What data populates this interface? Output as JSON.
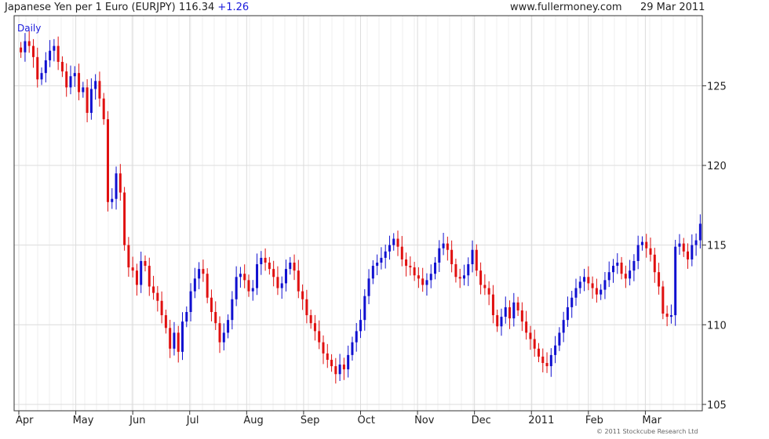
{
  "header": {
    "title": "Japanese Yen per 1 Euro (EURJPY) 116.34",
    "change": "+1.26",
    "site": "www.fullermoney.com",
    "date": "29 Mar 2011"
  },
  "copyright": "© 2011 Stockcube Research Ltd",
  "colors": {
    "up": "#1010d0",
    "down": "#e01010",
    "grid": "#dcdcdc",
    "axis": "#333333",
    "series_label": "#1a1adb"
  },
  "chart_data": {
    "type": "candlestick",
    "series_label": "Daily",
    "ylim": [
      104.6,
      129.4
    ],
    "y_ticks": [
      105,
      110,
      115,
      120,
      125
    ],
    "x_labels": [
      "Apr",
      "May",
      "Jun",
      "Jul",
      "Aug",
      "Sep",
      "Oct",
      "Nov",
      "Dec",
      "2011",
      "Feb",
      "Mar"
    ],
    "grid": true,
    "y_axis_side": "right",
    "close": [
      127.1,
      127.8,
      127.5,
      126.8,
      125.4,
      125.8,
      126.6,
      127.2,
      127.5,
      126.5,
      125.9,
      124.9,
      125.6,
      125.8,
      124.6,
      124.9,
      123.3,
      124.8,
      125.3,
      124.2,
      122.9,
      117.7,
      117.9,
      119.5,
      118.3,
      115.0,
      113.6,
      113.4,
      112.5,
      114.0,
      113.7,
      112.4,
      112.0,
      111.5,
      110.6,
      109.8,
      108.5,
      109.5,
      108.3,
      110.2,
      110.8,
      112.1,
      112.9,
      113.5,
      113.2,
      111.7,
      110.8,
      110.1,
      108.9,
      109.5,
      110.3,
      111.6,
      113.0,
      113.2,
      112.8,
      112.1,
      112.3,
      113.8,
      114.2,
      113.9,
      113.5,
      113.0,
      112.3,
      112.6,
      113.5,
      113.9,
      113.4,
      112.1,
      111.6,
      110.6,
      110.1,
      109.6,
      108.9,
      108.2,
      107.8,
      107.4,
      106.9,
      107.5,
      107.2,
      108.1,
      108.9,
      109.6,
      110.3,
      111.8,
      112.9,
      113.7,
      113.9,
      114.2,
      114.6,
      115.0,
      115.4,
      114.9,
      114.1,
      113.7,
      113.6,
      113.1,
      112.9,
      112.5,
      112.8,
      113.2,
      113.9,
      114.8,
      115.1,
      114.7,
      113.8,
      113.0,
      112.9,
      113.1,
      113.8,
      114.7,
      113.4,
      112.5,
      112.3,
      111.9,
      110.6,
      109.9,
      110.5,
      111.1,
      110.4,
      111.4,
      110.9,
      110.2,
      109.5,
      109.1,
      108.5,
      108.0,
      107.6,
      107.4,
      108.1,
      108.7,
      109.5,
      110.3,
      111.1,
      111.7,
      112.3,
      112.7,
      113.0,
      112.6,
      112.3,
      111.9,
      112.2,
      112.8,
      113.3,
      113.7,
      113.9,
      113.2,
      112.9,
      113.4,
      114.0,
      115.0,
      115.2,
      114.8,
      114.4,
      113.3,
      112.4,
      110.7,
      110.5,
      110.6,
      114.9,
      115.1,
      114.6,
      114.1,
      115.0,
      115.3,
      116.34
    ]
  }
}
